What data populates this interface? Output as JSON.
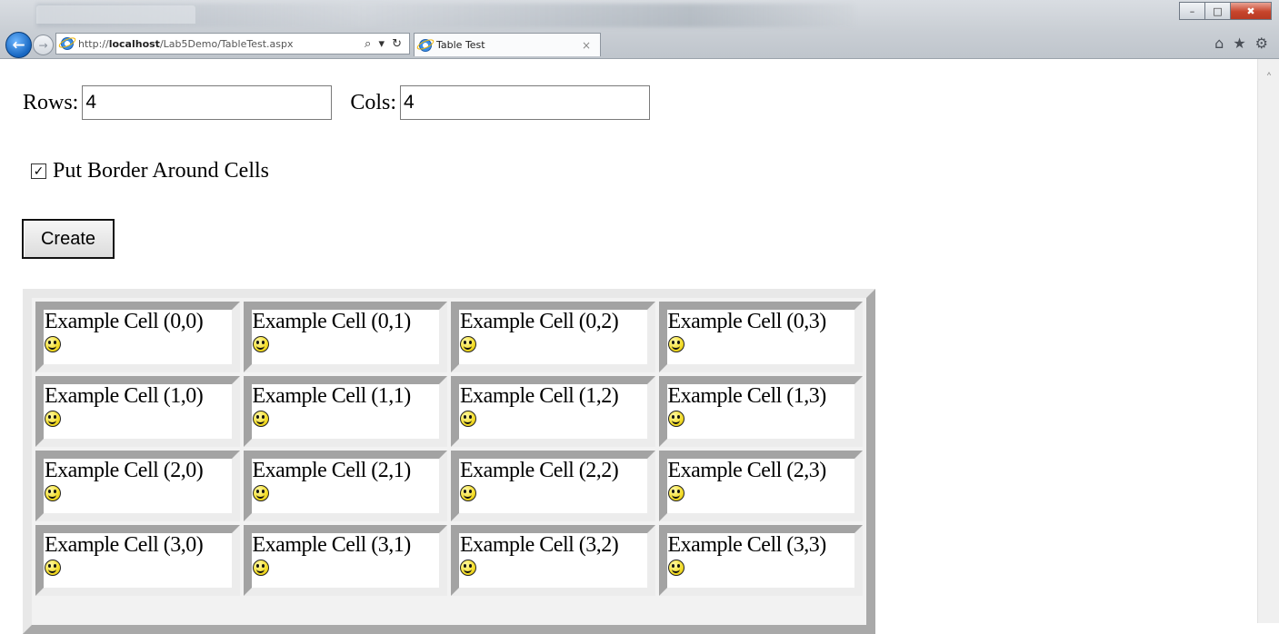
{
  "browser": {
    "address_url_prefix": "http://",
    "address_url_host": "localhost",
    "address_url_path": "/Lab5Demo/TableTest.aspx",
    "address_tools": "⌕ ▾ ↻",
    "tab_title": "Table Test",
    "tab_close": "×",
    "win_minimize": "–",
    "win_maximize": "□",
    "win_close": "✖",
    "home_icon": "⌂",
    "favorites_icon": "★",
    "settings_icon": "⚙",
    "back_icon": "←",
    "forward_icon": "→",
    "scroll_up_icon": "˄"
  },
  "form": {
    "rows_label": "Rows:",
    "rows_value": "4",
    "cols_label": "Cols:",
    "cols_value": "4",
    "border_checkbox_label": "Put Border Around Cells",
    "border_checkbox_mark": "✓",
    "create_button": "Create"
  },
  "table": {
    "rows": [
      [
        "Example Cell (0,0)",
        "Example Cell (0,1)",
        "Example Cell (0,2)",
        "Example Cell (0,3)"
      ],
      [
        "Example Cell (1,0)",
        "Example Cell (1,1)",
        "Example Cell (1,2)",
        "Example Cell (1,3)"
      ],
      [
        "Example Cell (2,0)",
        "Example Cell (2,1)",
        "Example Cell (2,2)",
        "Example Cell (2,3)"
      ],
      [
        "Example Cell (3,0)",
        "Example Cell (3,1)",
        "Example Cell (3,2)",
        "Example Cell (3,3)"
      ]
    ],
    "cell_icon": "smiley-icon"
  }
}
